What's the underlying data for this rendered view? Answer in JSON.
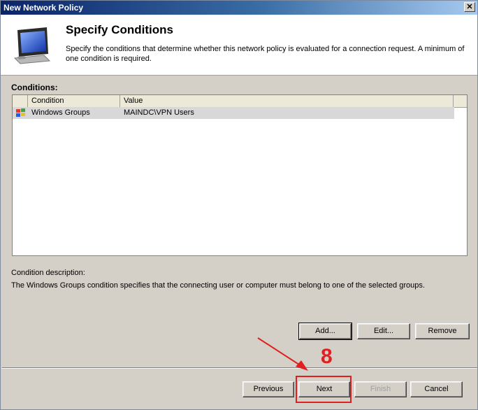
{
  "window": {
    "title": "New Network Policy",
    "close_glyph": "✕"
  },
  "header": {
    "title": "Specify Conditions",
    "description": "Specify the conditions that determine whether this network policy is evaluated for a connection request. A minimum of one condition is required.",
    "icon": "monitor-icon"
  },
  "conditions": {
    "label": "Conditions:",
    "columns": [
      "Condition",
      "Value"
    ],
    "rows": [
      {
        "icon": "windows-groups-icon",
        "condition": "Windows Groups",
        "value": "MAINDC\\VPN Users"
      }
    ]
  },
  "description": {
    "label": "Condition description:",
    "text": "The Windows Groups condition specifies that the connecting user or computer must belong to one of the selected groups."
  },
  "buttons": {
    "add": "Add...",
    "edit": "Edit...",
    "remove": "Remove",
    "previous": "Previous",
    "next": "Next",
    "finish": "Finish",
    "cancel": "Cancel"
  },
  "annotation": {
    "step": "8",
    "color": "#e02020"
  }
}
